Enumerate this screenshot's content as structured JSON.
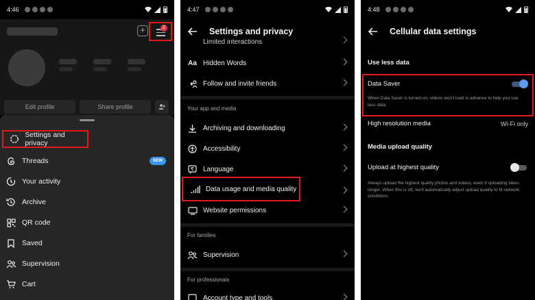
{
  "panel1": {
    "status_time": "4:46",
    "badge_count": "2",
    "edit_profile": "Edit profile",
    "share_profile": "Share profile",
    "menu": [
      {
        "label": "Settings and privacy",
        "icon": "settings-icon"
      },
      {
        "label": "Threads",
        "icon": "threads-icon",
        "badge": "NEW"
      },
      {
        "label": "Your activity",
        "icon": "activity-icon"
      },
      {
        "label": "Archive",
        "icon": "archive-icon"
      },
      {
        "label": "QR code",
        "icon": "qr-code-icon"
      },
      {
        "label": "Saved",
        "icon": "bookmark-icon"
      },
      {
        "label": "Supervision",
        "icon": "supervision-icon"
      },
      {
        "label": "Cart",
        "icon": "cart-icon"
      }
    ]
  },
  "panel2": {
    "status_time": "4:47",
    "title": "Settings and privacy",
    "items_top": [
      {
        "label": "Limited interactions"
      },
      {
        "label": "Hidden Words",
        "icon_text": "Aa"
      },
      {
        "label": "Follow and invite friends"
      }
    ],
    "section_app_media": "Your app and media",
    "items_app": [
      {
        "label": "Archiving and downloading"
      },
      {
        "label": "Accessibility"
      },
      {
        "label": "Language"
      },
      {
        "label": "Data usage and media quality"
      },
      {
        "label": "Website permissions"
      }
    ],
    "section_families": "For families",
    "supervision": "Supervision",
    "section_professionals": "For professionals",
    "account_type": "Account type and tools"
  },
  "panel3": {
    "status_time": "4:48",
    "title": "Cellular data settings",
    "use_less_data": "Use less data",
    "data_saver": "Data Saver",
    "data_saver_on": true,
    "data_saver_help": "When Data Saver is turned on, videos won't load in advance to help you use less data.",
    "high_res": "High resolution media",
    "high_res_value": "Wi-Fi only",
    "media_upload_quality": "Media upload quality",
    "upload_highest": "Upload at highest quality",
    "upload_highest_on": false,
    "upload_help": "Always upload the highest quality photos and videos, even if uploading takes longer. When this is off, we'll automatically adjust upload quality to fit network conditions."
  },
  "colors": {
    "highlight": "#e21c1c",
    "accent": "#3897f0",
    "background": "#000000"
  }
}
